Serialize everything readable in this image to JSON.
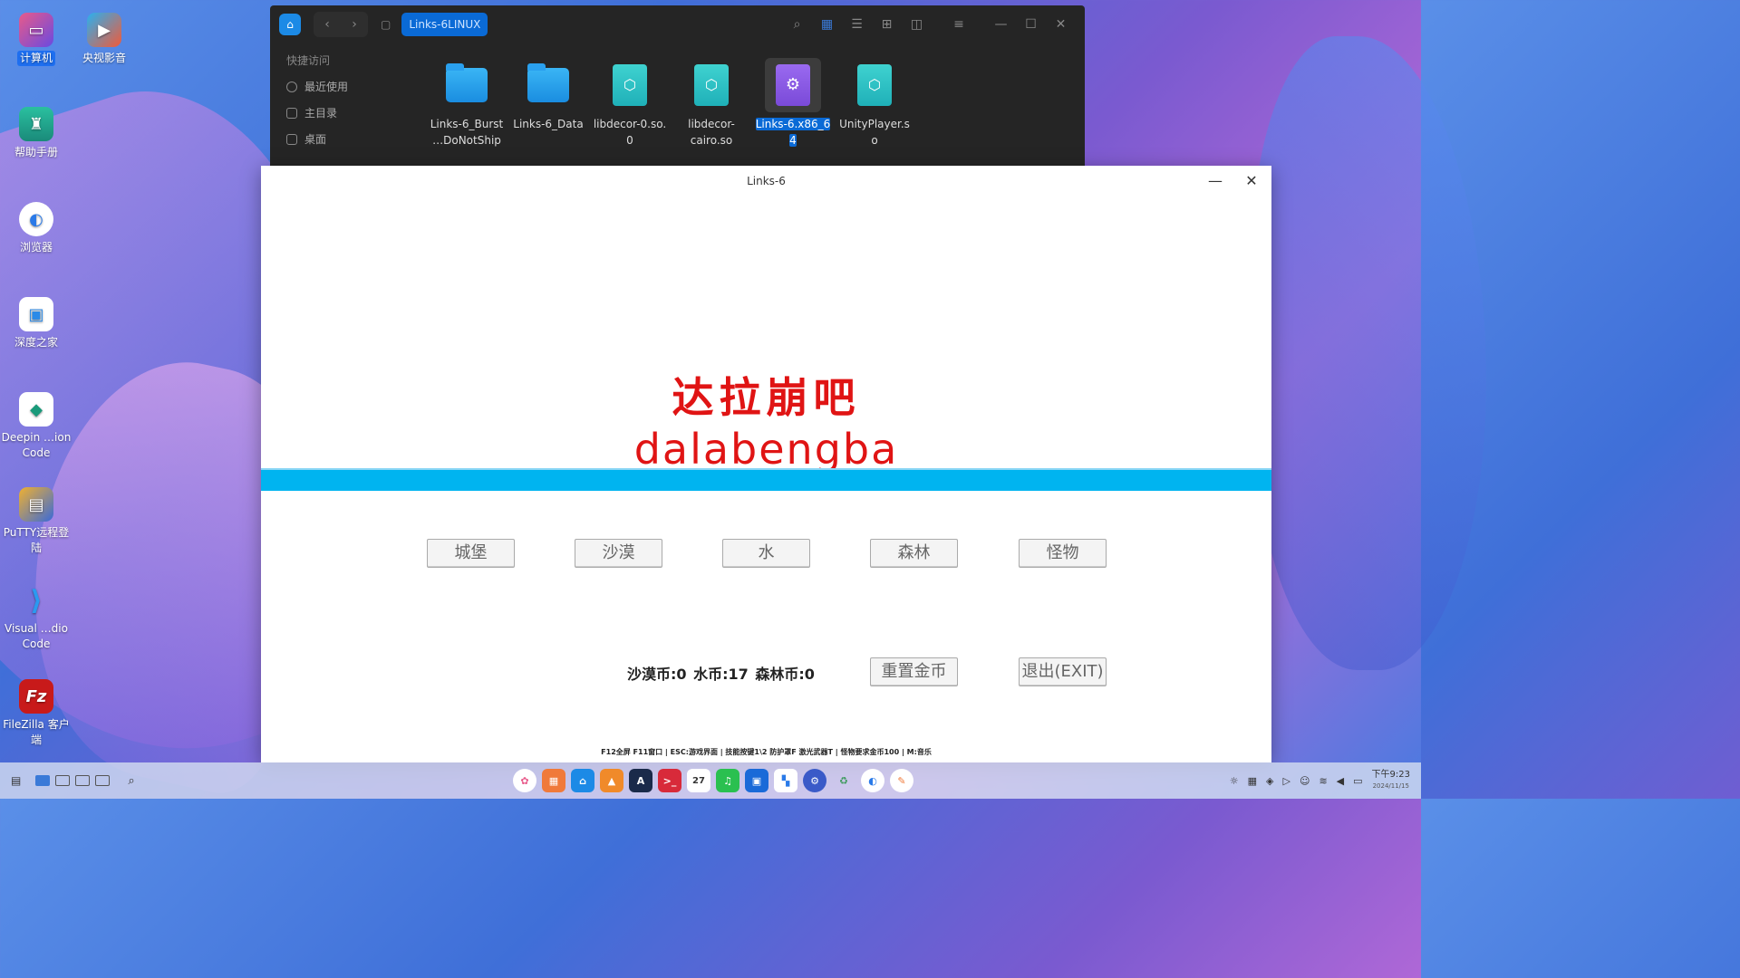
{
  "desktop": {
    "icons": [
      {
        "label": "计算机",
        "selected": true
      },
      {
        "label": "央视影音"
      },
      {
        "label": "帮助手册"
      },
      {
        "label": "浏览器"
      },
      {
        "label": "深度之家"
      },
      {
        "label": "Deepin …ion Code"
      },
      {
        "label": "PuTTY远程登陆"
      },
      {
        "label": "Visual …dio Code"
      },
      {
        "label": "FileZilla 客户端"
      }
    ]
  },
  "file_manager": {
    "breadcrumb": "Links-6LINUX",
    "sidebar_header": "快捷访问",
    "sidebar_items": [
      "最近使用",
      "主目录",
      "桌面"
    ],
    "files": [
      {
        "name_line1": "Links-6_Burst",
        "name_line2": "…DoNotShip"
      },
      {
        "name_line1": "Links-6_Data",
        "name_line2": ""
      },
      {
        "name_line1": "libdecor-0.so.",
        "name_line2": "0"
      },
      {
        "name_line1": "libdecor-",
        "name_line2": "cairo.so"
      },
      {
        "name_line1": "Links-6.x86_6",
        "name_line2": "4",
        "selected": true
      },
      {
        "name_line1": "UnityPlayer.s",
        "name_line2": "o"
      }
    ]
  },
  "game": {
    "window_title": "Links-6",
    "title_cn": "达拉崩吧",
    "title_en": "dalabengba",
    "buttons": {
      "castle": "城堡",
      "desert": "沙漠",
      "water": "水",
      "forest": "森林",
      "monster": "怪物",
      "reset": "重置金币",
      "exit": "退出(EXIT)"
    },
    "coins": "沙漠币:0  水币:17  森林币:0",
    "hint": "F12全屏 F11窗口 | ESC:游戏界面 | 技能按键1\\2  防护罩F 激光武器T | 怪物要求金币100  | M:音乐"
  },
  "taskbar": {
    "calendar_day": "27",
    "time": "下午9:23",
    "date": "2024/11/15"
  },
  "colors": {
    "accent": "#0a6ad6",
    "title_red": "#e01414",
    "band_blue": "#00b4f0"
  }
}
